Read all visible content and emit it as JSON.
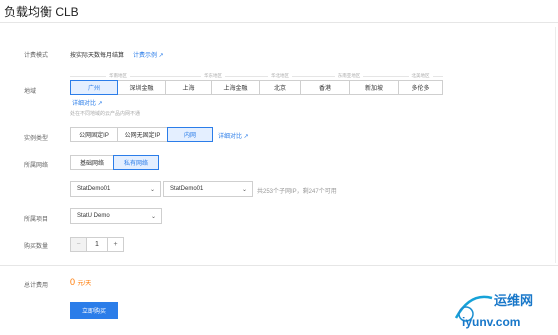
{
  "header": {
    "title": "负载均衡 CLB"
  },
  "billing": {
    "label": "计费模式",
    "value": "按实际天数每月结算",
    "link": "计费示例"
  },
  "region": {
    "label": "地域",
    "groups": [
      "华南地区",
      "华东地区",
      "华北地区",
      "东南亚地区",
      "北美地区"
    ],
    "options": [
      "广州",
      "深圳金融",
      "上海",
      "上海金融",
      "北京",
      "香港",
      "新加坡",
      "多伦多"
    ],
    "selected": "广州",
    "detail_link": "详细对比",
    "hint": "处在不同地域的云产品内网不通"
  },
  "instance_type": {
    "label": "实例类型",
    "options": [
      "公网固定IP",
      "公网无固定IP",
      "内网"
    ],
    "selected": "内网",
    "detail_link": "详细对比"
  },
  "network": {
    "label": "所属网络",
    "options": [
      "基础网络",
      "私有网络"
    ],
    "selected": "私有网络",
    "vpc_select": "StatDemo01",
    "subnet_select": "StatDemo01",
    "subnet_info": "共253个子网IP，剩247个可用"
  },
  "project": {
    "label": "所属项目",
    "select": "StatU Demo"
  },
  "quantity": {
    "label": "购买数量",
    "minus": "−",
    "value": "1",
    "plus": "+"
  },
  "total": {
    "label": "总计费用",
    "amount": "0",
    "unit": "元/天"
  },
  "buy_button": "立即购买",
  "watermark": {
    "cn": "运维网",
    "url": "iyunv.com"
  },
  "colors": {
    "accent": "#2b7de9",
    "price": "#ff7800"
  }
}
